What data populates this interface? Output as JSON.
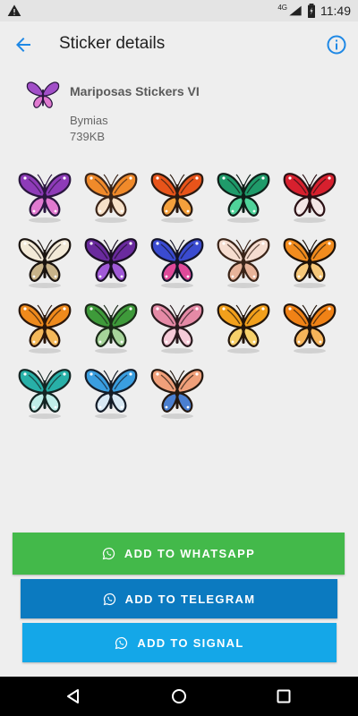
{
  "status_bar": {
    "time": "11:49",
    "network": "4G"
  },
  "app_bar": {
    "title": "Sticker details"
  },
  "pack": {
    "name": "Mariposas Stickers VI",
    "author": "Bymias",
    "size": "739KB"
  },
  "stickers": [
    {
      "name": "sticker-1",
      "colors": [
        "#8e3bb8",
        "#e07ad0",
        "#2b1640"
      ]
    },
    {
      "name": "sticker-2",
      "colors": [
        "#f08a2a",
        "#f6e0c8",
        "#3a2418"
      ]
    },
    {
      "name": "sticker-3",
      "colors": [
        "#e8541a",
        "#f4a03c",
        "#2b1a10"
      ]
    },
    {
      "name": "sticker-4",
      "colors": [
        "#1f9b6a",
        "#4fd39a",
        "#0e1e18"
      ]
    },
    {
      "name": "sticker-5",
      "colors": [
        "#d7202e",
        "#f2e4e4",
        "#2a1014"
      ]
    },
    {
      "name": "sticker-6",
      "colors": [
        "#f3ead8",
        "#c9b48a",
        "#1a1410"
      ]
    },
    {
      "name": "sticker-7",
      "colors": [
        "#6a2a9e",
        "#a15ad8",
        "#1a0f24"
      ]
    },
    {
      "name": "sticker-8",
      "colors": [
        "#3a4bd0",
        "#e04a9a",
        "#141428"
      ]
    },
    {
      "name": "sticker-9",
      "colors": [
        "#f6ddd0",
        "#e8b49a",
        "#3a2418"
      ]
    },
    {
      "name": "sticker-10",
      "colors": [
        "#f28c1e",
        "#f6c87a",
        "#1e1208"
      ]
    },
    {
      "name": "sticker-11",
      "colors": [
        "#ef8a1c",
        "#f4b85a",
        "#2a160a"
      ]
    },
    {
      "name": "sticker-12",
      "colors": [
        "#3e9a3a",
        "#a6d49a",
        "#1a2a18"
      ]
    },
    {
      "name": "sticker-13",
      "colors": [
        "#e58aa6",
        "#f6cbd8",
        "#2a1a1e"
      ]
    },
    {
      "name": "sticker-14",
      "colors": [
        "#f2a01c",
        "#f7d06a",
        "#24160a"
      ]
    },
    {
      "name": "sticker-15",
      "colors": [
        "#f08216",
        "#f6b45a",
        "#22140a"
      ]
    },
    {
      "name": "sticker-16",
      "colors": [
        "#28b0a8",
        "#bfeee8",
        "#142624"
      ]
    },
    {
      "name": "sticker-17",
      "colors": [
        "#3a9ee0",
        "#d8e8f4",
        "#141c28"
      ]
    },
    {
      "name": "sticker-18",
      "colors": [
        "#f0a07a",
        "#4a7fd0",
        "#241810"
      ]
    }
  ],
  "buttons": {
    "whatsapp": "ADD TO WHATSAPP",
    "telegram": "ADD TO TELEGRAM",
    "signal": "ADD TO SIGNAL"
  },
  "colors": {
    "accent": "#1e88e5",
    "whatsapp": "#43b94a",
    "telegram": "#0b7ac0",
    "signal": "#14a7e8"
  },
  "icons": {
    "back": "arrow-back-icon",
    "info": "info-icon",
    "warning": "warning-icon",
    "wifi": "wifi-icon",
    "battery": "battery-icon",
    "whatsapp": "whatsapp-icon",
    "nav_back": "nav-back-icon",
    "nav_home": "nav-home-icon",
    "nav_recents": "nav-recents-icon"
  }
}
